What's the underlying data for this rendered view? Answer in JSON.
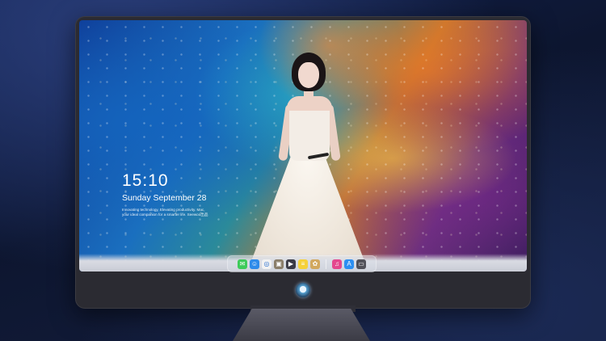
{
  "lockscreen": {
    "time": "15:10",
    "date": "Sunday September 28",
    "tagline": "Innovating technology, Elevating productivity. Mac, your ideal companion for a smarter life. Seewoo出品"
  },
  "dock": {
    "items": [
      {
        "name": "messages-icon",
        "glyph": "✉",
        "color": "#3ecb5a"
      },
      {
        "name": "finder-icon",
        "glyph": "☺",
        "color": "#2e8bea"
      },
      {
        "name": "safari-icon",
        "glyph": "◎",
        "color": "#f2f2f2"
      },
      {
        "name": "preview-icon",
        "glyph": "▣",
        "color": "#8a7e6a"
      },
      {
        "name": "imovie-icon",
        "glyph": "▶",
        "color": "#3a3a46"
      },
      {
        "name": "notes-icon",
        "glyph": "≡",
        "color": "#f5d13a"
      },
      {
        "name": "photos-icon",
        "glyph": "✿",
        "color": "#d2a85e"
      },
      {
        "name": "music-icon",
        "glyph": "♫",
        "color": "#e4478e"
      },
      {
        "name": "app-store-icon",
        "glyph": "A",
        "color": "#2c8ff1"
      },
      {
        "name": "terminal-icon",
        "glyph": "▭",
        "color": "#505058"
      }
    ]
  },
  "colors": {
    "bezel": "#2b2b32",
    "text": "#ffffff"
  }
}
